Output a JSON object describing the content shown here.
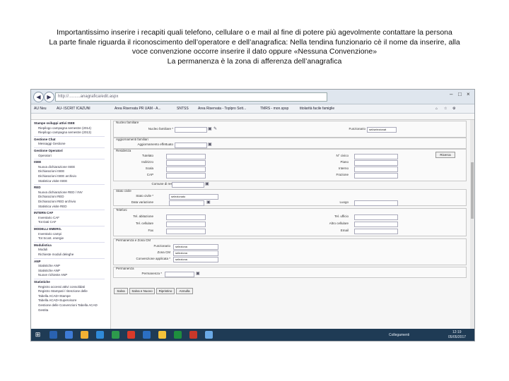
{
  "caption": {
    "lines": [
      "Importantissimo inserire i recapiti quali telefono, cellulare o e mail al fine di potere più agevolmente contattare la persona",
      "La parte finale riguarda il riconoscimento dell’operatore e dell’anagrafica: Nella tendina funzionario cè il nome da inserire, alla",
      "voce convenzione occorre inserire il dato oppure «Nessuna Convenzione»",
      "La permanenza è la zona di afferenza dell’anagrafica"
    ]
  },
  "browser": {
    "url": "http://..........anagrafica/edit.aspx",
    "tabs": [
      "AU- ISCRIT ICAZUNI",
      "Area Riservata PR UAM - A...",
      "SNTSS",
      "Area Riservata - Toplpro Sott...",
      "TMRS - mon.spsp",
      "titolarità facile famiglie"
    ],
    "home_label": "AU Neu",
    "window_controls": [
      "–",
      "□",
      "×"
    ]
  },
  "sidebar": {
    "items": [
      {
        "label": "Stampe sviluppi attivi ISEE",
        "head": true
      },
      {
        "label": "Riepilogo campagna semestre (2014)",
        "head": false
      },
      {
        "label": "Riepilogo campagna semestre (2013)",
        "head": false
      },
      {
        "label": "Gestione Chat",
        "head": true
      },
      {
        "label": "Messaggi Gestione",
        "head": false
      },
      {
        "label": "Gestione Operatori",
        "head": true
      },
      {
        "label": "Operatori",
        "head": false
      },
      {
        "label": "ISEE",
        "head": true
      },
      {
        "label": "Nuova dichiarazione ISEE",
        "head": false
      },
      {
        "label": "Dichiarazioni ISEE",
        "head": false
      },
      {
        "label": "Dichiarazioni ISEE archivio",
        "head": false
      },
      {
        "label": "Statistica visite ISEE",
        "head": false
      },
      {
        "label": "RED",
        "head": true
      },
      {
        "label": "Nuova dichiarazione RED / INV",
        "head": false
      },
      {
        "label": "Dichiarazioni RED",
        "head": false
      },
      {
        "label": "Dichiarazioni RED archivio",
        "head": false
      },
      {
        "label": "Statistica visite RED",
        "head": false
      },
      {
        "label": "INTERN CAF",
        "head": true
      },
      {
        "label": "Inventario CAF",
        "head": false
      },
      {
        "label": "Tot Dati CAF",
        "head": false
      },
      {
        "label": "MODELLI EMERG.",
        "head": true
      },
      {
        "label": "Inventario campi",
        "head": false
      },
      {
        "label": "Tot Scost. energie",
        "head": false
      },
      {
        "label": "Modulistica",
        "head": true
      },
      {
        "label": "Moduli",
        "head": false
      },
      {
        "label": "Richieste moduli deleghe",
        "head": false
      },
      {
        "label": "ANP",
        "head": true
      },
      {
        "label": "Statistiche ANP",
        "head": false
      },
      {
        "label": "Statistiche ANP",
        "head": false
      },
      {
        "label": "Nuove richieste ANP",
        "head": false
      },
      {
        "label": "Statistiche",
        "head": true
      },
      {
        "label": "Registro accessi attivi consolidati",
        "head": false
      },
      {
        "label": "Registro Stampati / ritenzione delle",
        "head": false
      },
      {
        "label": "Tabella ACAD+Stampe",
        "head": false
      },
      {
        "label": "Tabella ACAD+Supervisore",
        "head": false
      },
      {
        "label": "Gestione delle Convenzioni Tabella ACAD",
        "head": false
      },
      {
        "label": "Gestita",
        "head": false
      }
    ]
  },
  "form": {
    "sections": {
      "nucleo": "Nucleo familiare",
      "aggiornamenti": "Aggiornamenti familiari",
      "residenza": "Residenza",
      "stato_civile": "Stato civile",
      "telefoni": "Telefoni",
      "permanenza_zona": "Permanenza e Zona CM",
      "permanenza": "Permanenza"
    },
    "labels": {
      "nucleo_familiare": "Nucleo familiare *",
      "aggiornamento": "Aggiornamento effettuato",
      "tutelato": "Tutelato",
      "indirizzo": "Indirizzo",
      "civico": "Civico",
      "scala": "Scala",
      "cap": "CAP",
      "comune_residenza": "Comune di residenza",
      "n_civico": "N° civico",
      "piano": "Piano",
      "interno": "Interno",
      "frazione": "Frazione",
      "funzionario_r": "Funzionario",
      "stato_civile": "Stato civile *",
      "data_variazione": "Data variazione",
      "luogo": "Luogo",
      "tel_abitazione": "Tel. abitazione",
      "tel_cellulare": "Tel. cellulare",
      "fax": "Fax",
      "tel_ufficio": "Tel. ufficio",
      "altro_cellulare": "Altro cellulare",
      "email": "Email",
      "funzionario": "Funzionario",
      "zona_cm": "Zona CM",
      "convenzione": "Convenzione applicata *",
      "permanenza": "Permanenza *"
    },
    "selects": {
      "funzionario_top": "sel/selezionat",
      "stato_civile": "selezionato",
      "funzionario": "seleziona",
      "zona_cm": "seleziona",
      "convenzione": "seleziona"
    },
    "side_button": "Ricerca",
    "buttons": [
      "Salva",
      "Salva e Nuovo",
      "Ripristino",
      "Annulla"
    ]
  },
  "taskbar": {
    "status": "Collegamenti",
    "time": "12:19",
    "date": "05/05/2017",
    "colors": [
      "#2a62b0",
      "#3e7bd6",
      "#f2b134",
      "#2f8ad8",
      "#2d9a4c",
      "#d83a2a",
      "#2b6fc2",
      "#f3c13a",
      "#1e8f3e",
      "#c8382a",
      "#6aa9e6"
    ]
  }
}
